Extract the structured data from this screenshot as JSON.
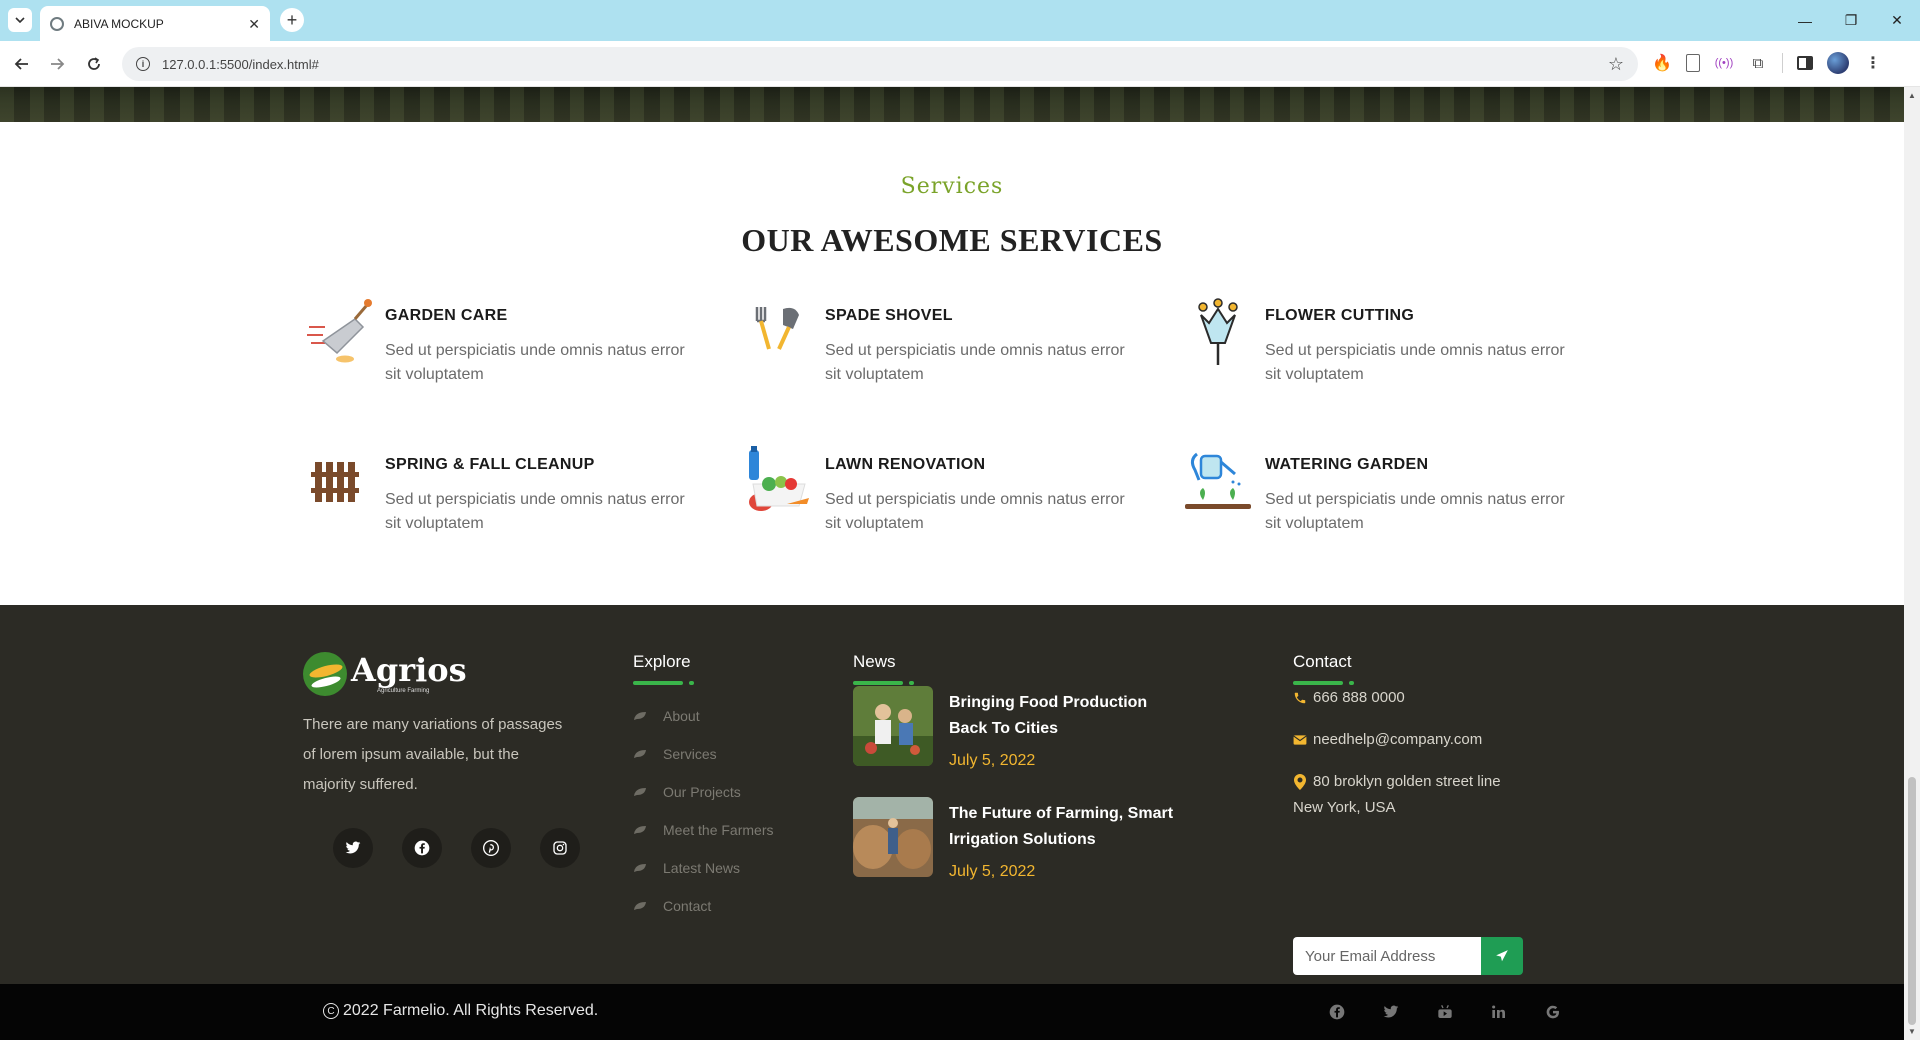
{
  "browser": {
    "tab_title": "ABIVA MOCKUP",
    "tab_close": "✕",
    "new_tab": "+",
    "url": "127.0.0.1:5500/index.html#",
    "window_controls": {
      "minimize": "—",
      "restore": "❐",
      "close": "✕"
    }
  },
  "services": {
    "kicker": "Services",
    "title": "OUR AWESOME SERVICES",
    "items": [
      {
        "title": "GARDEN CARE",
        "desc": "Sed ut perspiciatis unde omnis natus error sit voluptatem",
        "icon": "trowel-icon"
      },
      {
        "title": "SPADE SHOVEL",
        "desc": "Sed ut perspiciatis unde omnis natus error sit voluptatem",
        "icon": "fork-shovel-icon"
      },
      {
        "title": "FLOWER CUTTING",
        "desc": "Sed ut perspiciatis unde omnis natus error sit voluptatem",
        "icon": "flower-icon"
      },
      {
        "title": "SPRING & FALL CLEANUP",
        "desc": "Sed ut perspiciatis unde omnis natus error sit voluptatem",
        "icon": "fence-icon"
      },
      {
        "title": "LAWN RENOVATION",
        "desc": "Sed ut perspiciatis unde omnis natus error sit voluptatem",
        "icon": "vegetables-icon"
      },
      {
        "title": "WATERING GARDEN",
        "desc": "Sed ut perspiciatis unde omnis natus error sit voluptatem",
        "icon": "watering-can-icon"
      }
    ]
  },
  "footer": {
    "logo_text": "Agrios",
    "logo_sub": "Agriculture Farming",
    "about": "There are many variations of passages of lorem ipsum available, but the majority suffered.",
    "explore": {
      "heading": "Explore",
      "items": [
        "About",
        "Services",
        "Our Projects",
        "Meet the Farmers",
        "Latest News",
        "Contact"
      ]
    },
    "news": {
      "heading": "News",
      "items": [
        {
          "title": "Bringing Food Production Back To Cities",
          "date": "July 5, 2022"
        },
        {
          "title": "The Future of Farming, Smart Irrigation Solutions",
          "date": "July 5, 2022"
        }
      ]
    },
    "contact": {
      "heading": "Contact",
      "phone": "666 888 0000",
      "email": "needhelp@company.com",
      "address": "80 broklyn golden street line New York, USA",
      "email_placeholder": "Your Email Address"
    }
  },
  "bottom_bar": {
    "copyright": "2022 Farmelio. All Rights Reserved."
  },
  "colors": {
    "accent_green": "#3ab54a",
    "kicker_green": "#7aa329",
    "date_yellow": "#f2b630",
    "footer_bg": "#2c2b25",
    "subscribe_green": "#1f9d54"
  }
}
